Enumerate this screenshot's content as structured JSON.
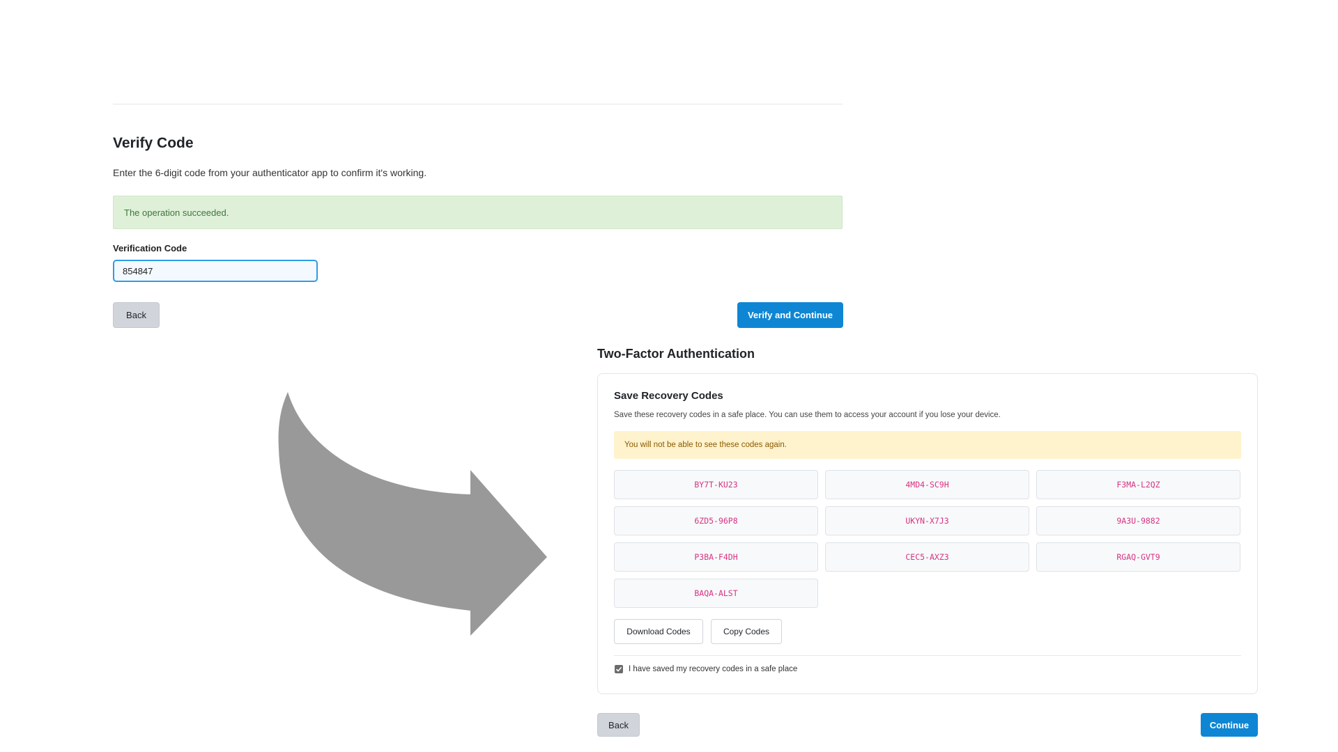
{
  "verify": {
    "title": "Verify Code",
    "description": "Enter the 6-digit code from your authenticator app to confirm it's working.",
    "success_message": "The operation succeeded.",
    "field_label": "Verification Code",
    "field_value": "854847",
    "back_label": "Back",
    "submit_label": "Verify and Continue"
  },
  "twofa": {
    "title": "Two-Factor Authentication",
    "card_title": "Save Recovery Codes",
    "card_description": "Save these recovery codes in a safe place. You can use them to access your account if you lose your device.",
    "warning": "You will not be able to see these codes again.",
    "codes": [
      "BY7T-KU23",
      "4MD4-SC9H",
      "F3MA-L2QZ",
      "6ZD5-96P8",
      "UKYN-X7J3",
      "9A3U-9882",
      "P3BA-F4DH",
      "CEC5-AXZ3",
      "RGAQ-GVT9",
      "BAQA-ALST"
    ],
    "download_label": "Download Codes",
    "copy_label": "Copy Codes",
    "confirm_label": "I have saved my recovery codes in a safe place",
    "confirm_checked": true,
    "back_label": "Back",
    "continue_label": "Continue"
  },
  "decor": {
    "arrow_icon": "curved-arrow-icon",
    "arrow_color": "#999999",
    "primary_color": "#0e86d4",
    "success_bg": "#dff0d8",
    "warning_bg": "#fff3cd",
    "code_text_color": "#d63384"
  }
}
